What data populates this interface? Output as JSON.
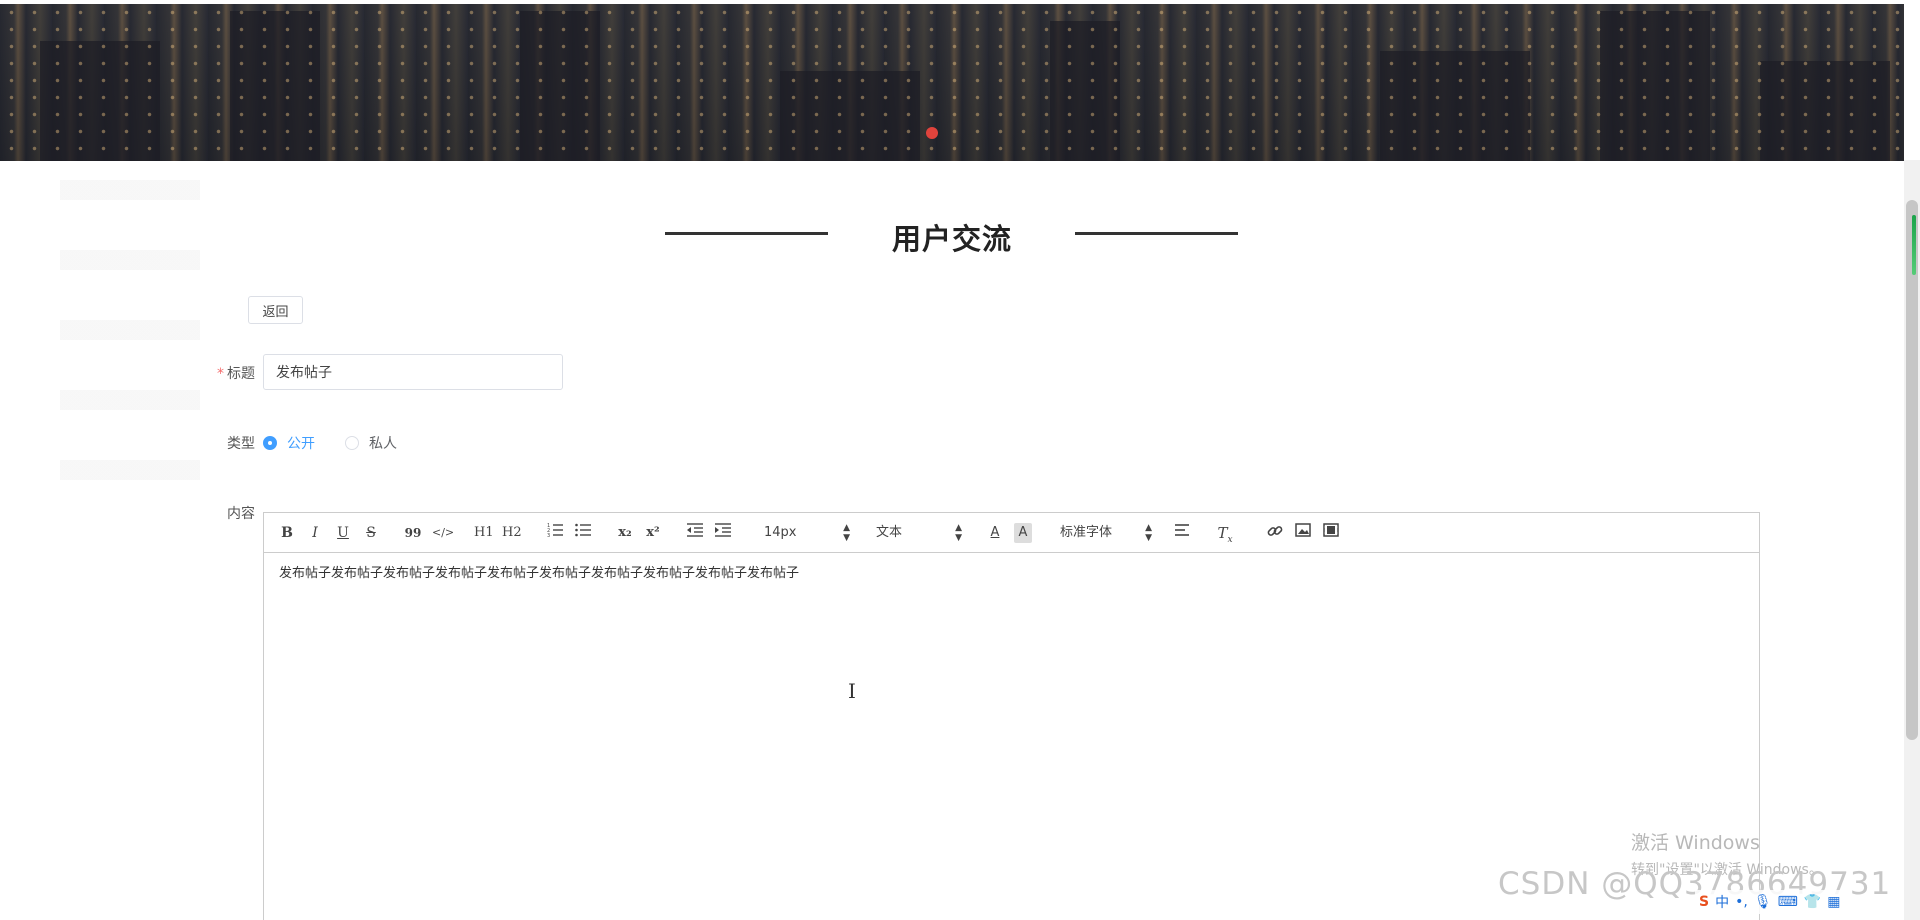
{
  "section": {
    "title": "用户交流"
  },
  "back_button": {
    "label": "返回"
  },
  "form": {
    "title_label": "标题",
    "required_mark": "*",
    "title_value": "发布帖子",
    "type_label": "类型",
    "type_options": [
      {
        "label": "公开",
        "checked": true
      },
      {
        "label": "私人",
        "checked": false
      }
    ],
    "content_label": "内容"
  },
  "editor": {
    "toolbar": {
      "bold": "B",
      "italic": "I",
      "underline": "U",
      "strike": "S",
      "blockquote": "99",
      "code": "</>",
      "h1": "H1",
      "h2": "H2",
      "subscript": "x₂",
      "superscript": "x²",
      "size": "14px",
      "header": "文本",
      "font": "标准字体"
    },
    "content": "发布帖子发布帖子发布帖子发布帖子发布帖子发布帖子发布帖子发布帖子发布帖子发布帖子"
  },
  "watermark": {
    "windows_line1": "激活 Windows",
    "windows_line2": "转到\"设置\"以激活 Windows。",
    "csdn": "CSDN @QQ3786649731"
  },
  "ime": {
    "lang": "中"
  },
  "colors": {
    "accent": "#409eff",
    "dot": "#e0433c",
    "required": "#f56c6c"
  }
}
